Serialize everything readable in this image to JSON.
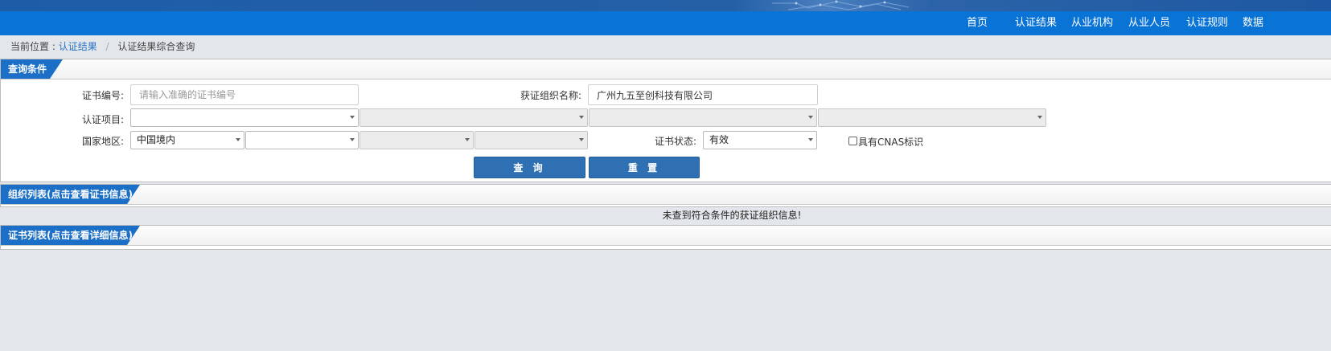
{
  "nav": {
    "items": [
      "首页",
      "认证结果",
      "从业机构",
      "从业人员",
      "认证规则",
      "数据"
    ]
  },
  "breadcrumb": {
    "prefix": "当前位置 :",
    "link": "认证结果",
    "separator": "/",
    "current": "认证结果综合查询"
  },
  "query": {
    "title": "查询条件",
    "cert_no_label": "证书编号:",
    "cert_no_placeholder": "请输入准确的证书编号",
    "org_name_label": "获证组织名称:",
    "org_name_value": "广州九五至创科技有限公司",
    "project_label": "认证项目:",
    "region_label": "国家地区:",
    "region_value": "中国境内",
    "status_label": "证书状态:",
    "status_value": "有效",
    "cnas_label": "具有CNAS标识",
    "cnas_checked": false,
    "search_button": "查 询",
    "reset_button": "重 置"
  },
  "org_list": {
    "title": "组织列表(点击查看证书信息)",
    "empty_message": "未查到符合条件的获证组织信息!"
  },
  "cert_list": {
    "title": "证书列表(点击查看详细信息)"
  },
  "colors": {
    "nav_blue": "#0a73d6",
    "tab_blue": "#1b6fc6",
    "button_blue": "#2f70b3",
    "page_bg": "#e3e7eb"
  }
}
